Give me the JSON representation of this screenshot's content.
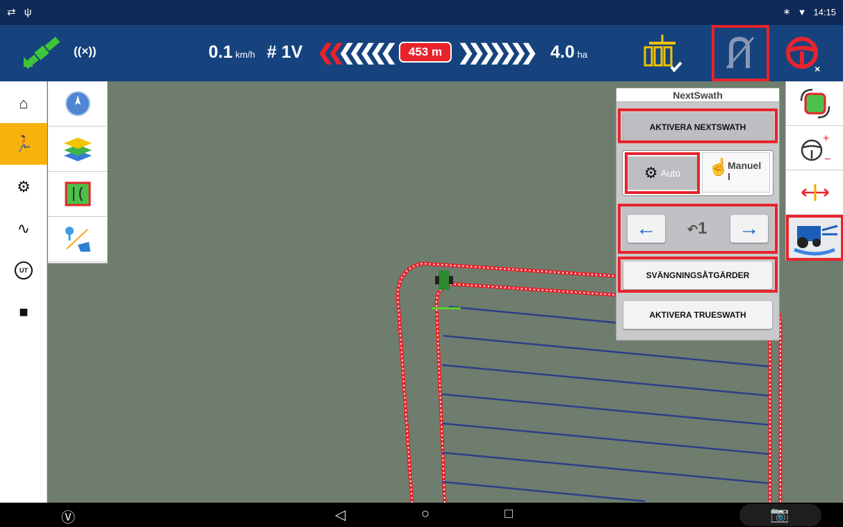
{
  "status_bar": {
    "time": "14:15"
  },
  "toolbar": {
    "gnss_label": "((×))",
    "speed_value": "0.1",
    "speed_unit": "km/h",
    "swath_number": "# 1V",
    "distance": "453 m",
    "area_value": "4.0",
    "area_unit": "ha"
  },
  "panel": {
    "title": "NextSwath",
    "activate_nextswath": "AKTIVERA NEXTSWATH",
    "auto_label": "Auto",
    "manual_label": "Manuel\nl",
    "swath_step": "1",
    "turn_actions": "SVÄNGNINGSÅTGÄRDER",
    "activate_trueswath": "AKTIVERA TRUESWATH"
  },
  "left_sidebar": {
    "items": [
      "home-icon",
      "run-icon",
      "field-settings-icon",
      "diagnostics-icon",
      "ut-icon",
      "camera-icon"
    ],
    "active_index": 1,
    "ut_label": "UT"
  },
  "colors": {
    "topbar": "#16437e",
    "highlight": "#e8232c",
    "active": "#f7b30c",
    "map": "#6e7d6d",
    "guidance_line": "#2c3f8a"
  }
}
